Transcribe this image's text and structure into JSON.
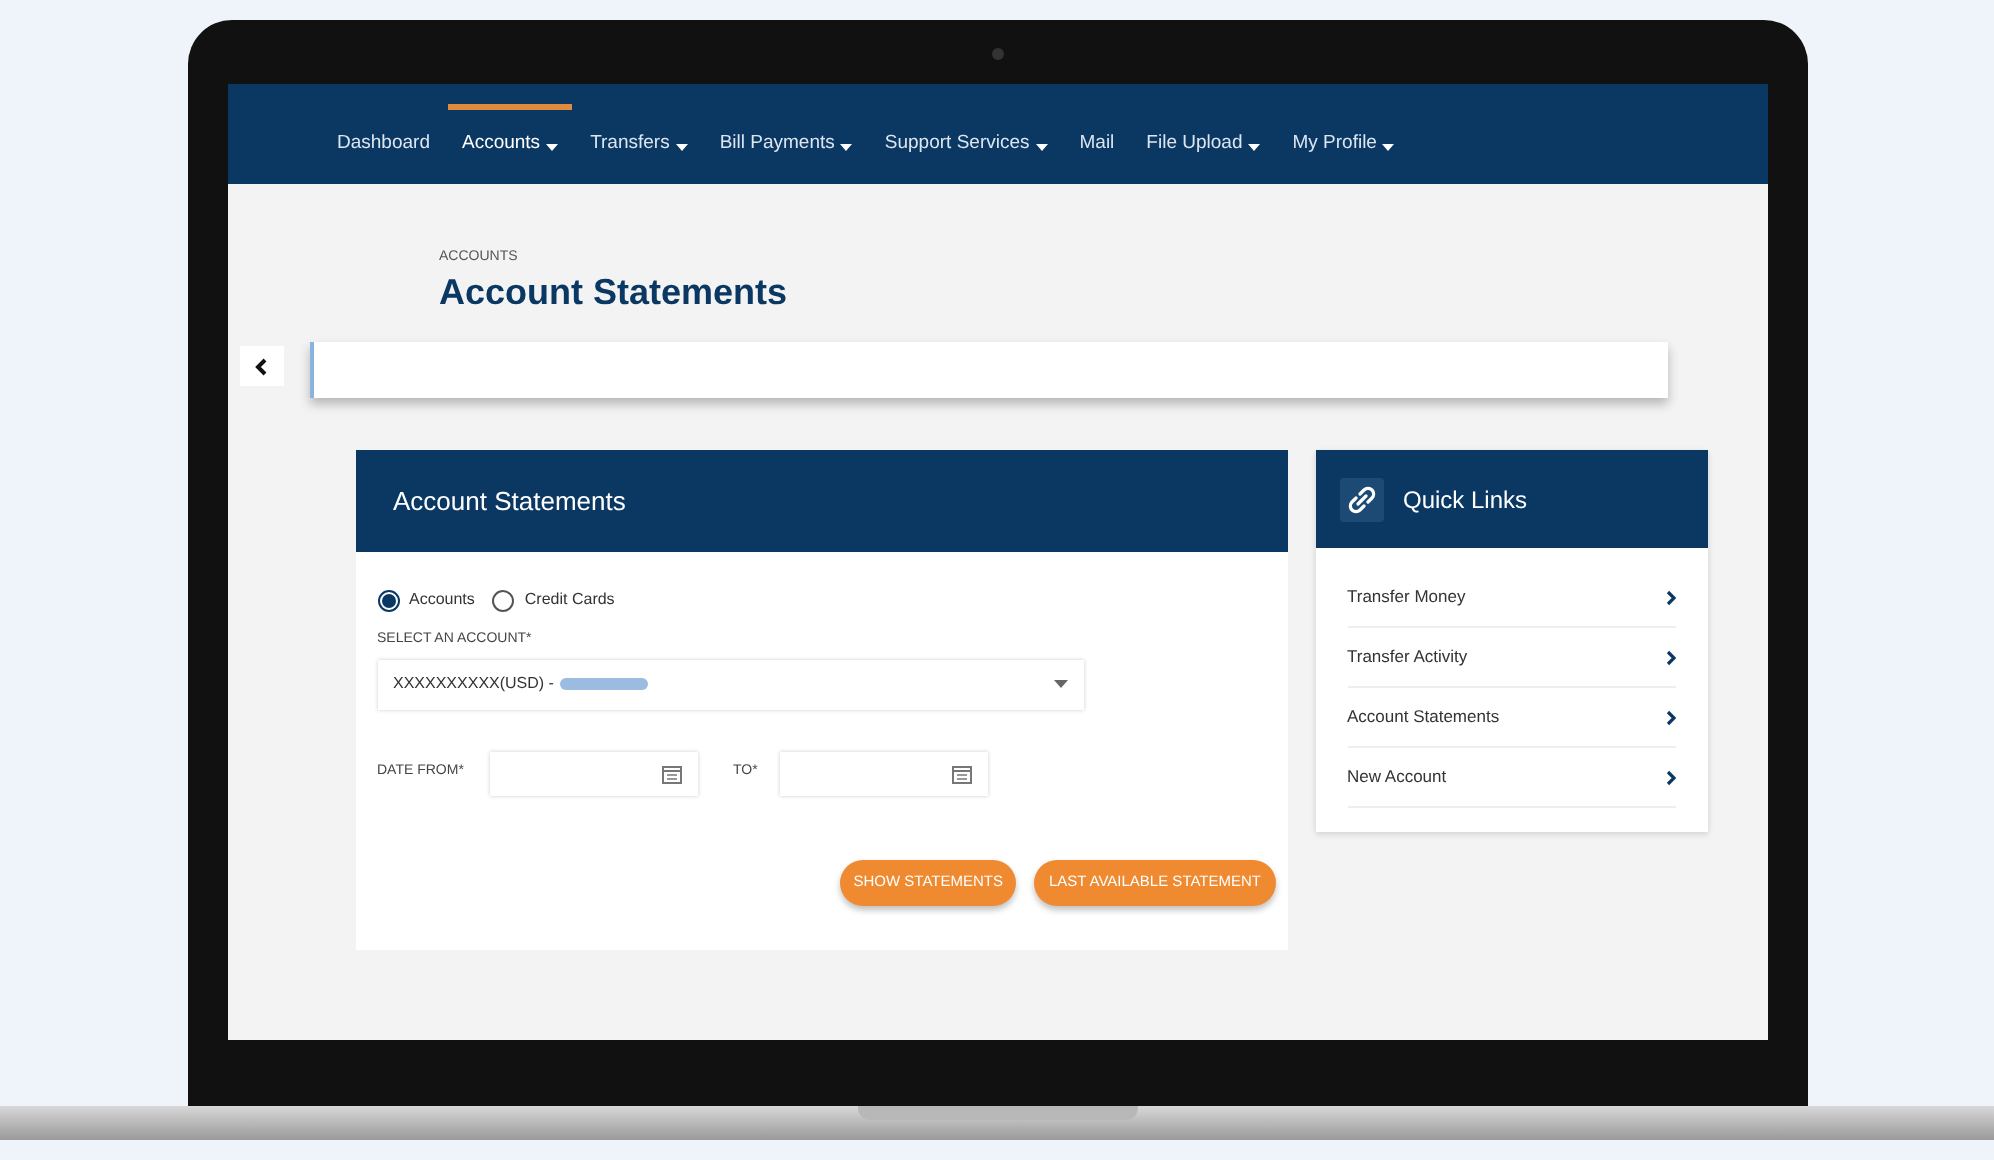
{
  "nav": [
    {
      "label": "Dashboard",
      "dropdown": false,
      "selected": false
    },
    {
      "label": "Accounts",
      "dropdown": true,
      "selected": true
    },
    {
      "label": "Transfers",
      "dropdown": true,
      "selected": false
    },
    {
      "label": "Bill Payments",
      "dropdown": true,
      "selected": false
    },
    {
      "label": "Support Services",
      "dropdown": true,
      "selected": false
    },
    {
      "label": "Mail",
      "dropdown": false,
      "selected": false
    },
    {
      "label": "File Upload",
      "dropdown": true,
      "selected": false
    },
    {
      "label": "My Profile",
      "dropdown": true,
      "selected": false
    }
  ],
  "page": {
    "breadcrumb": "ACCOUNTS",
    "title": "Account Statements"
  },
  "form": {
    "title": "Account Statements",
    "account_types": [
      {
        "label": "Accounts",
        "selected": true
      },
      {
        "label": "Credit Cards",
        "selected": false
      }
    ],
    "account_label": "SELECT AN ACCOUNT*",
    "account_value": "XXXXXXXXXX(USD) -",
    "date_from_label": "DATE FROM*",
    "to_label": "TO*",
    "buttons": [
      "SHOW STATEMENTS",
      "LAST AVAILABLE STATEMENT"
    ]
  },
  "quick_links": {
    "title": "Quick Links",
    "items": [
      "Transfer Money",
      "Transfer Activity",
      "Account Statements",
      "New Account"
    ]
  }
}
